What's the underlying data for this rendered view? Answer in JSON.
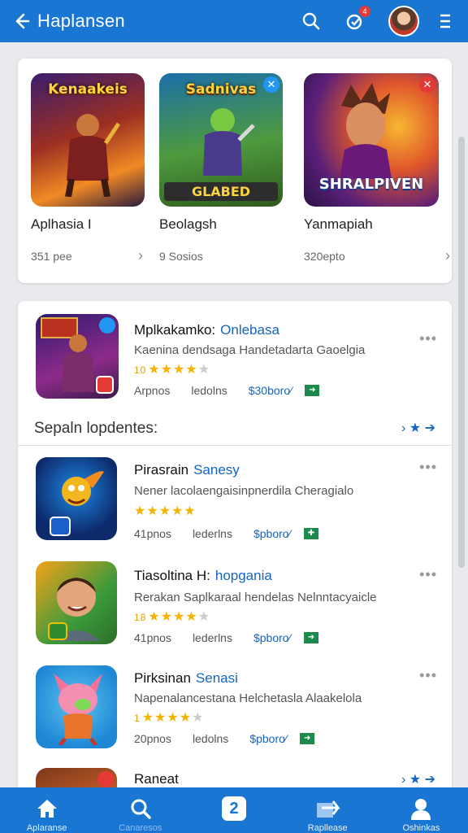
{
  "header": {
    "title": "Haplansen",
    "notification_count": "4"
  },
  "featured": [
    {
      "art_title": "Kenaakeis",
      "name": "Aplhasia I",
      "meta": "351 pee",
      "corner_color": "#2196f3"
    },
    {
      "art_title": "Sadnivas",
      "art_sub": "GLABED",
      "name": "Beolagsh",
      "meta": "9 Sosios",
      "corner_color": "#2196f3"
    },
    {
      "art_title": "SHRALPIVEN",
      "name": "Yanmapiah",
      "meta": "320epto",
      "corner_color": "#e53935"
    }
  ],
  "top_item": {
    "title": "Mplkakamko:",
    "developer": "Onlebasa",
    "desc": "Kaenina dendsaga Handetadarta Gaoelgia",
    "rating_prefix": "10",
    "meta": {
      "size": "Arpnos",
      "installs": "ledolns",
      "price": "$30boro"
    }
  },
  "section": {
    "label": "Sepaln lopdentes:"
  },
  "items": [
    {
      "title": "Pirasrain",
      "developer": "Sanesy",
      "desc": "Nener lacolaengaisinpnerdila Cheragialo",
      "rating_prefix": "",
      "meta": {
        "size": "41pnos",
        "installs": "lederlns",
        "price": "$pboro"
      }
    },
    {
      "title": "Tiasoltina H:",
      "developer": "hopgania",
      "desc": "Rerakan Saplkaraal hendelas Nelnntacyaicle",
      "rating_prefix": "18",
      "meta": {
        "size": "41pnos",
        "installs": "lederlns",
        "price": "$pboro"
      }
    },
    {
      "title": "Pirksinan",
      "developer": "Senasi",
      "desc": "Napenalancestana Helchetasla Alaakelola",
      "rating_prefix": "1",
      "meta": {
        "size": "20pnos",
        "installs": "ledolns",
        "price": "$pboro"
      }
    },
    {
      "title": "Raneat"
    }
  ],
  "bottom_nav": [
    {
      "label": "Aplaranse",
      "icon": "home-icon"
    },
    {
      "label": "Canaresos",
      "icon": "search-icon"
    },
    {
      "label": "",
      "icon": "apps-icon"
    },
    {
      "label": "Rapllease",
      "icon": "updates-icon"
    },
    {
      "label": "Oshinkas",
      "icon": "profile-icon"
    }
  ],
  "colors": {
    "primary": "#1976d2",
    "link": "#1565c0",
    "star": "#f5b301"
  }
}
